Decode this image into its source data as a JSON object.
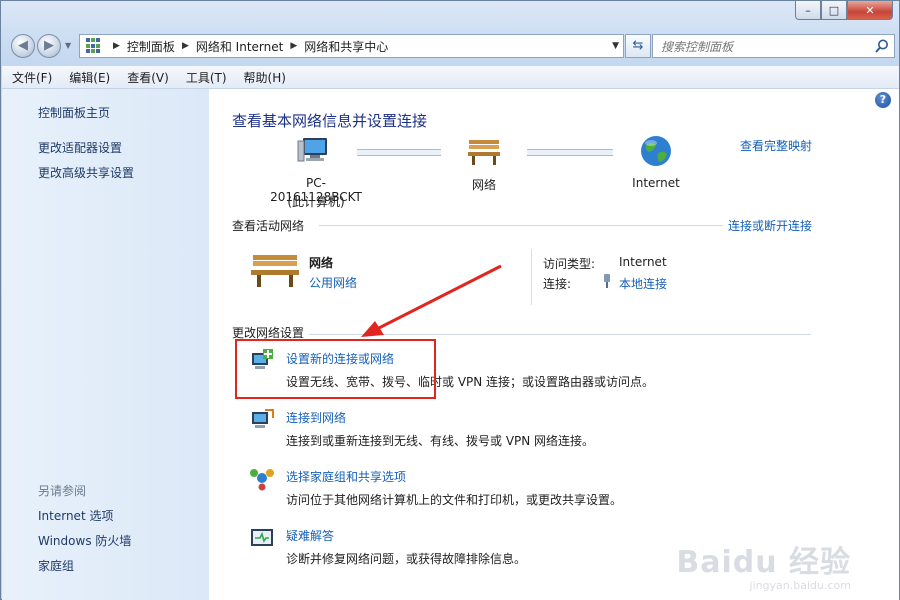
{
  "window": {
    "caption_buttons": {
      "minimize": "–",
      "maximize": "□",
      "close": "✕"
    }
  },
  "nav": {
    "back_icon": "back-arrow",
    "forward_icon": "forward-arrow",
    "breadcrumbs": [
      "控制面板",
      "网络和 Internet",
      "网络和共享中心"
    ],
    "search_placeholder": "搜索控制面板"
  },
  "menu": [
    "文件(F)",
    "编辑(E)",
    "查看(V)",
    "工具(T)",
    "帮助(H)"
  ],
  "sidebar": {
    "links": [
      "控制面板主页",
      "更改适配器设置",
      "更改高级共享设置"
    ],
    "see_also_title": "另请参阅",
    "see_also": [
      "Internet 选项",
      "Windows 防火墙",
      "家庭组"
    ]
  },
  "main": {
    "help": "?",
    "title": "查看基本网络信息并设置连接",
    "full_map_link": "查看完整映射",
    "map": {
      "computer": {
        "name": "PC-20161128BCKT",
        "sub": "(此计算机)"
      },
      "network": "网络",
      "internet": "Internet"
    },
    "active": {
      "title": "查看活动网络",
      "connect_link": "连接或断开连接",
      "network_name": "网络",
      "network_type": "公用网络",
      "access_label": "访问类型:",
      "access_value": "Internet",
      "conn_label": "连接:",
      "conn_value": "本地连接"
    },
    "change": {
      "title": "更改网络设置",
      "tasks": [
        {
          "title": "设置新的连接或网络",
          "desc": "设置无线、宽带、拨号、临时或 VPN 连接；或设置路由器或访问点。"
        },
        {
          "title": "连接到网络",
          "desc": "连接到或重新连接到无线、有线、拨号或 VPN 网络连接。"
        },
        {
          "title": "选择家庭组和共享选项",
          "desc": "访问位于其他网络计算机上的文件和打印机，或更改共享设置。"
        },
        {
          "title": "疑难解答",
          "desc": "诊断并修复网络问题，或获得故障排除信息。"
        }
      ]
    }
  },
  "watermark": {
    "logo": "Baidu 经验",
    "sub": "jingyan.baidu.com"
  },
  "colors": {
    "link": "#1660b8",
    "title": "#1e3287",
    "highlight": "#e0261f"
  }
}
